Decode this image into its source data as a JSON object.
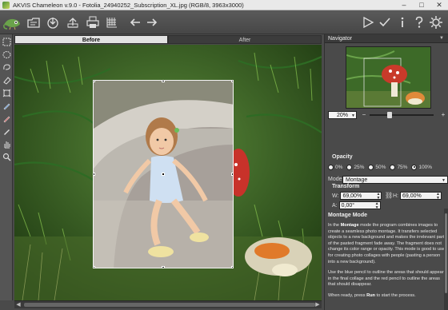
{
  "window": {
    "title": "AKVIS Chameleon v.9.0 - Fotolia_24940252_Subscription_XL.jpg (RGB/8, 3963x3000)",
    "minimize_glyph": "–",
    "maximize_glyph": "□",
    "close_glyph": "✕"
  },
  "toolbar": {
    "icons": [
      "open-icon",
      "save-icon",
      "upload-icon",
      "print-icon",
      "fill-icon",
      "grid-icon",
      "back-arrow-icon",
      "forward-arrow-icon",
      "run-icon",
      "apply-icon",
      "info-icon",
      "help-icon",
      "settings-icon"
    ]
  },
  "tabs": {
    "before": "Before",
    "after": "After"
  },
  "navigator": {
    "title": "Navigator",
    "zoom": "20%",
    "minus": "−",
    "plus": "+"
  },
  "opacity": {
    "title": "Opacity",
    "options": [
      "0%",
      "25%",
      "50%",
      "75%",
      "100%"
    ],
    "selected": "100%"
  },
  "mode": {
    "label": "Mode",
    "value": "Montage"
  },
  "transform": {
    "title": "Transform",
    "w_label": "W:",
    "w_value": "69,00%",
    "h_label": "H:",
    "h_value": "69,00%",
    "a_label": "A:",
    "a_value": "0,00°"
  },
  "help": {
    "title": "Montage Mode",
    "p1_a": "In the ",
    "p1_b": "Montage",
    "p1_c": " mode the program combines images to create a seamless photo montage. It transfers selected objects to a new background and makes the irrelevant parts of the pasted fragment fade away. The fragment does not change its color range or opacity. This mode is good to use for creating photo collages with people (pasting a person into a new background).",
    "p2": "Use the blue pencil to outline the areas that should appear in the final collage and the red pencil to outline the areas that should disappear.",
    "p3_a": "When ready, press ",
    "p3_b": "Run",
    "p3_c": " to start the process."
  },
  "colors": {
    "panel_bg": "#4a4a4a",
    "tab_active": "#e2e2e2",
    "field_bg": "#f2f2f2"
  }
}
